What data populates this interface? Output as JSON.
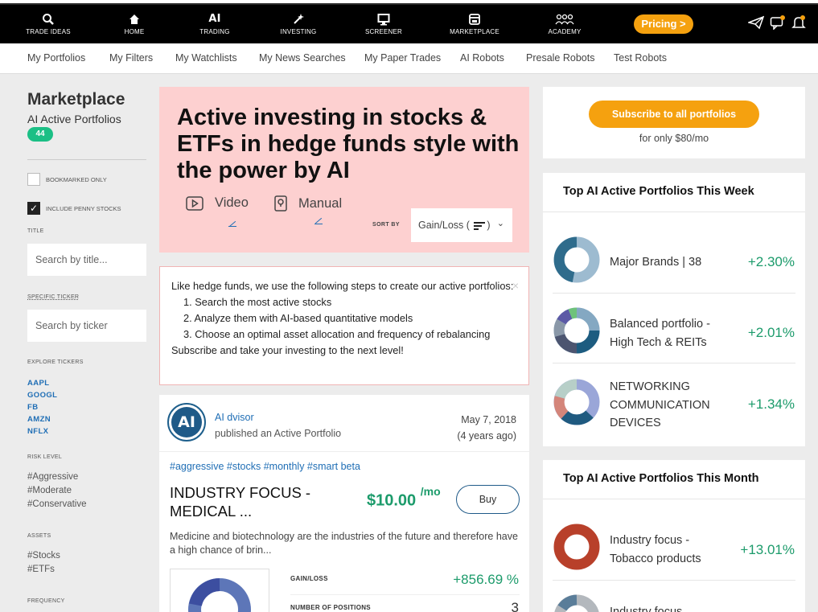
{
  "topnav": {
    "items": [
      {
        "label": "TRADE IDEAS",
        "icon": "search-icon"
      },
      {
        "label": "HOME",
        "icon": "home-icon"
      },
      {
        "label": "TRADING",
        "icon": "ai-icon",
        "glyph": "AI"
      },
      {
        "label": "INVESTING",
        "icon": "magic-wand-icon"
      },
      {
        "label": "SCREENER",
        "icon": "monitor-icon"
      },
      {
        "label": "MARKETPLACE",
        "icon": "store-icon"
      },
      {
        "label": "ACADEMY",
        "icon": "people-icon"
      }
    ],
    "pricing": "Pricing >"
  },
  "subnav": [
    "My Portfolios",
    "My Filters",
    "My Watchlists",
    "My News Searches",
    "My Paper Trades",
    "AI Robots",
    "Presale Robots",
    "Test Robots"
  ],
  "sidebar": {
    "title": "Marketplace",
    "subtitle": "AI Active Portfolios",
    "count": "44",
    "bookmarked": "BOOKMARKED ONLY",
    "penny": "INCLUDE PENNY STOCKS",
    "title_label": "TITLE",
    "title_placeholder": "Search by title...",
    "ticker_label": "SPECIFIC TICKER",
    "ticker_placeholder": "Search by ticker",
    "explore_label": "EXPLORE TICKERS",
    "tickers": [
      "AAPL",
      "GOOGL",
      "FB",
      "AMZN",
      "NFLX"
    ],
    "risk_label": "RISK LEVEL",
    "risk": [
      "#Aggressive",
      "#Moderate",
      "#Conservative"
    ],
    "assets_label": "ASSETS",
    "assets": [
      "#Stocks",
      "#ETFs"
    ],
    "frequency_label": "FREQUENCY"
  },
  "hero": {
    "title": "Active investing in stocks & ETFs in hedge funds style with the power by AI",
    "video": "Video",
    "manual": "Manual",
    "sort_label": "SORT BY",
    "sort_value": "Gain/Loss ("
  },
  "info": {
    "intro": "Like hedge funds, we use the following steps to create our active portfolios:",
    "steps": [
      "1. Search the most active stocks",
      "2. Analyze them with AI-based quantitative models",
      "3. Choose an optimal asset allocation and frequency of rebalancing"
    ],
    "outro": "Subscribe and take your investing to the next level!",
    "close": "×"
  },
  "card": {
    "avatar": "AI",
    "author": "AI dvisor",
    "action": "published an Active Portfolio",
    "date": "May 7, 2018",
    "ago": "(4 years ago)",
    "hashtags": "#aggressive #stocks #monthly #smart beta",
    "title": "INDUSTRY FOCUS - MEDICAL ...",
    "price": "$10.00",
    "per": "/mo",
    "buy": "Buy",
    "description": "Medicine and biotechnology are the industries of the future and therefore have a high chance of brin...",
    "gain_label": "GAIN/LOSS",
    "gain": "+856.69 %",
    "positions_label": "NUMBER OF POSITIONS",
    "positions": "3"
  },
  "subscribe": {
    "button": "Subscribe to all portfolios",
    "price": "for only $80/mo"
  },
  "week": {
    "title": "Top AI Active Portfolios This Week",
    "items": [
      {
        "name": "Major Brands | 38",
        "pct": "+2.30%"
      },
      {
        "name": "Balanced portfolio - High Tech & REITs",
        "pct": "+2.01%"
      },
      {
        "name": "NETWORKING COMMUNICATION DEVICES",
        "pct": "+1.34%"
      }
    ]
  },
  "month": {
    "title": "Top AI Active Portfolios This Month",
    "items": [
      {
        "name": "Industry focus - Tobacco products",
        "pct": "+13.01%"
      },
      {
        "name": "Industry focus",
        "pct": ""
      }
    ]
  },
  "colors": {
    "accent": "#f5a10f",
    "positive": "#1c9b6b",
    "link": "#1f6eb5",
    "hero_bg": "#fdd0d0"
  }
}
